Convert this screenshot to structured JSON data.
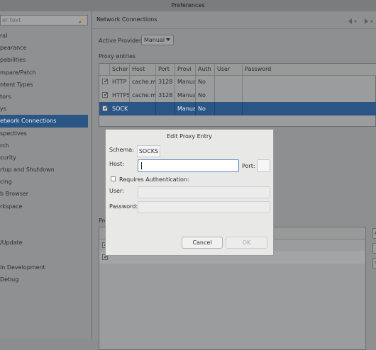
{
  "window": {
    "title": "Preferences"
  },
  "sidebar": {
    "filter_placeholder": "er text",
    "items": [
      {
        "label": "ral"
      },
      {
        "label": "pearance"
      },
      {
        "label": "pabilities"
      },
      {
        "label": "mpare/Patch"
      },
      {
        "label": "ntent Types"
      },
      {
        "label": "tors"
      },
      {
        "label": "ys"
      },
      {
        "label": "etwork Connections",
        "selected": true
      },
      {
        "label": "spectives"
      },
      {
        "label": "rch"
      },
      {
        "label": "curity"
      },
      {
        "label": "rtup and Shutdown"
      },
      {
        "label": "cing"
      },
      {
        "label": "b Browser"
      },
      {
        "label": "rkspace"
      },
      {
        "label": ""
      },
      {
        "label": ""
      },
      {
        "label": "/Update"
      },
      {
        "label": ""
      },
      {
        "label": "in Development"
      },
      {
        "label": "Debug"
      }
    ]
  },
  "page": {
    "title": "Network Connections",
    "provider_label": "Active Provider:",
    "provider_value": "Manual",
    "proxy_entries_label": "Proxy entries",
    "proxy_columns": [
      "Scher",
      "Host",
      "Port",
      "Provi",
      "Auth",
      "User",
      "Password"
    ],
    "proxy_rows": [
      {
        "checked": true,
        "schema": "HTTP",
        "host": "cache.mr",
        "port": "3128",
        "provider": "Manua",
        "auth": "No",
        "user": "",
        "password": ""
      },
      {
        "checked": true,
        "schema": "HTTPS",
        "host": "cache.mr",
        "port": "3128",
        "provider": "Manua",
        "auth": "No",
        "user": "",
        "password": ""
      },
      {
        "checked": true,
        "schema": "SOCK",
        "host": "",
        "port": "",
        "provider": "Manua",
        "auth": "No",
        "user": "",
        "password": "",
        "selected": true
      }
    ],
    "lower_label": "Pro",
    "side_buttons": [
      "Ad",
      "",
      "R"
    ]
  },
  "dialog": {
    "title": "Edit Proxy Entry",
    "schema_label": "Schema:",
    "schema_value": "SOCKS",
    "host_label": "Host:",
    "host_value": "",
    "port_label": "Port:",
    "port_value": "",
    "requires_auth_label": "Requires Authentication:",
    "user_label": "User:",
    "password_label": "Password:",
    "cancel_label": "Cancel",
    "ok_label": "OK"
  },
  "colors": {
    "selection": "#2a5585",
    "dialog_bg": "#e8e8e7",
    "focus_border": "#5a86bb"
  }
}
